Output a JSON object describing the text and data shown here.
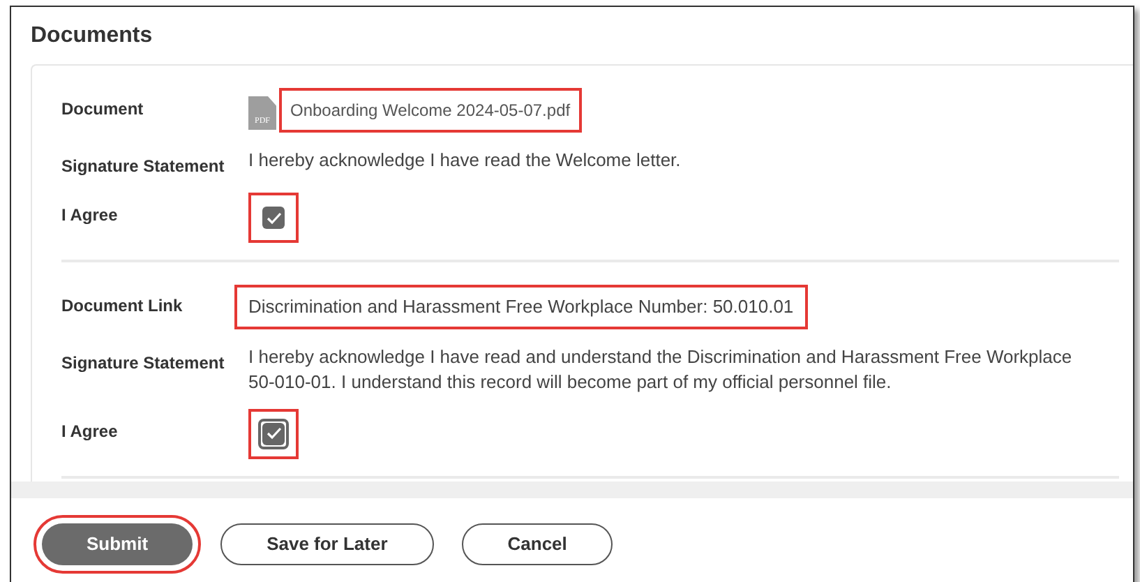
{
  "title": "Documents",
  "sections": [
    {
      "rows": [
        {
          "kind": "file",
          "label": "Document",
          "value": "Onboarding Welcome 2024-05-07.pdf",
          "icon_text": "PDF",
          "highlighted": true
        },
        {
          "kind": "text",
          "label": "Signature Statement",
          "value": "I hereby acknowledge I have read the Welcome letter."
        },
        {
          "kind": "checkbox",
          "label": "I Agree",
          "checked": true,
          "focused": false,
          "highlighted": true
        }
      ]
    },
    {
      "rows": [
        {
          "kind": "link",
          "label": "Document Link",
          "value": "Discrimination and Harassment Free Workplace Number: 50.010.01",
          "highlighted": true
        },
        {
          "kind": "text",
          "label": "Signature Statement",
          "value": "I hereby acknowledge I have read and understand the Discrimination and Harassment Free Workplace 50-010-01. I understand this record will become part of my official personnel file."
        },
        {
          "kind": "checkbox",
          "label": "I Agree",
          "checked": true,
          "focused": true,
          "highlighted": true
        }
      ]
    }
  ],
  "buttons": [
    {
      "label": "Submit",
      "primary": true,
      "highlighted": true
    },
    {
      "label": "Save for Later",
      "primary": false,
      "highlighted": false
    },
    {
      "label": "Cancel",
      "primary": false,
      "highlighted": false
    }
  ]
}
